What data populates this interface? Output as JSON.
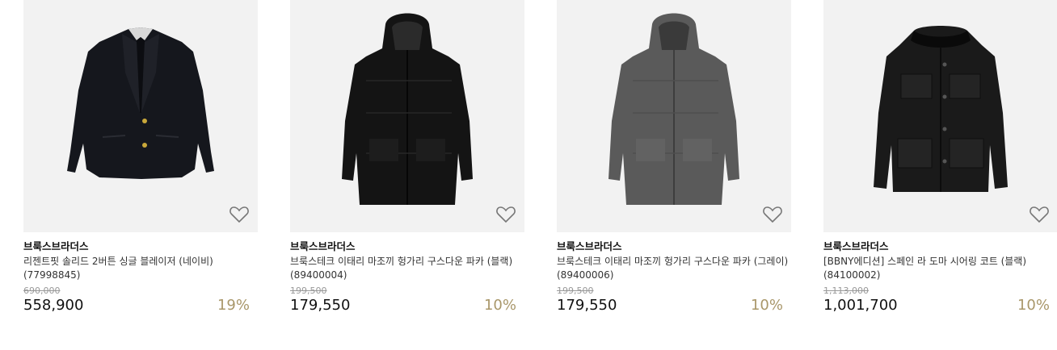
{
  "products": [
    {
      "brand": "브룩스브라더스",
      "name": "리젠트핏 솔리드 2버튼 싱글 블레이저 (네이비) (77998845)",
      "original_price": "690,000",
      "price": "558,900",
      "discount": "19%",
      "garment_color": "#14161c",
      "image_kind": "blazer",
      "wish_icon": "heart-outline-icon"
    },
    {
      "brand": "브룩스브라더스",
      "name": "브룩스테크 이태리 마조끼 헝가리 구스다운 파카 (블랙) (89400004)",
      "original_price": "199,500",
      "price": "179,550",
      "discount": "10%",
      "garment_color": "#151515",
      "image_kind": "parka",
      "wish_icon": "heart-outline-icon"
    },
    {
      "brand": "브룩스브라더스",
      "name": "브룩스테크 이태리 마조끼 헝가리 구스다운 파카 (그레이) (89400006)",
      "original_price": "199,500",
      "price": "179,550",
      "discount": "10%",
      "garment_color": "#5a5a5a",
      "image_kind": "parka",
      "wish_icon": "heart-outline-icon"
    },
    {
      "brand": "브룩스브라더스",
      "name": "[BBNY에디션] 스페인 라 도마 시어링 코트 (블랙) (84100002)",
      "original_price": "1,113,000",
      "price": "1,001,700",
      "discount": "10%",
      "garment_color": "#1a1a1a",
      "image_kind": "shearling-coat",
      "wish_icon": "heart-outline-icon"
    }
  ]
}
